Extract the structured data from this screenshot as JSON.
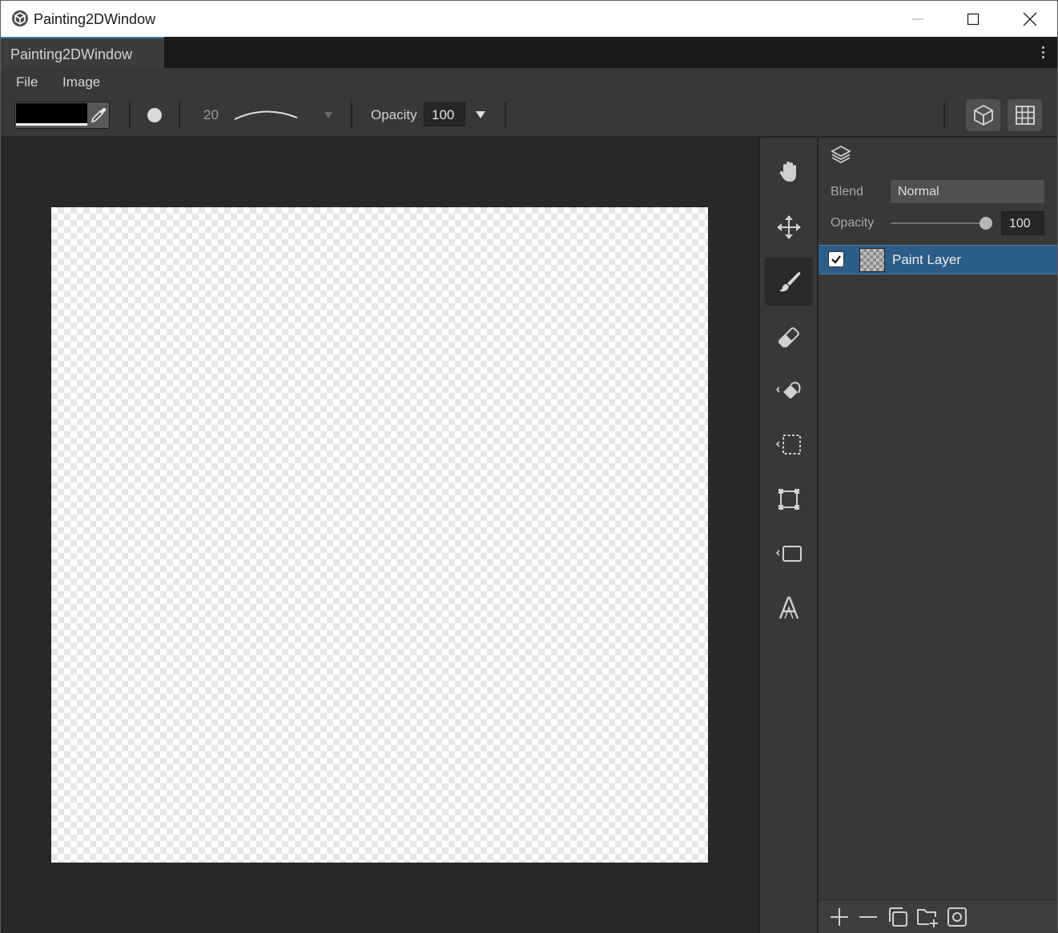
{
  "window": {
    "title": "Painting2DWindow"
  },
  "tab": {
    "label": "Painting2DWindow"
  },
  "menu": {
    "items": [
      "File",
      "Image"
    ]
  },
  "toolbar": {
    "primary_color": "#000000",
    "brush_size": "20",
    "opacity_label": "Opacity",
    "opacity_value": "100"
  },
  "tools": [
    "hand-icon",
    "move-icon",
    "brush-icon",
    "eraser-icon",
    "fill-bucket-icon",
    "selection-icon",
    "transform-icon",
    "shape-icon",
    "text-icon"
  ],
  "active_tool": "brush-icon",
  "layers_panel": {
    "blend_label": "Blend",
    "blend_value": "Normal",
    "opacity_label": "Opacity",
    "opacity_value": "100",
    "opacity_level": 1.0,
    "layers": [
      {
        "name": "Paint Layer",
        "visible": true,
        "selected": true
      }
    ],
    "footer_buttons": [
      "add-layer-icon",
      "remove-layer-icon",
      "duplicate-layer-icon",
      "add-group-icon",
      "mask-icon"
    ]
  },
  "colors": {
    "accent": "#3a79bb",
    "selection": "#2c5d87"
  }
}
